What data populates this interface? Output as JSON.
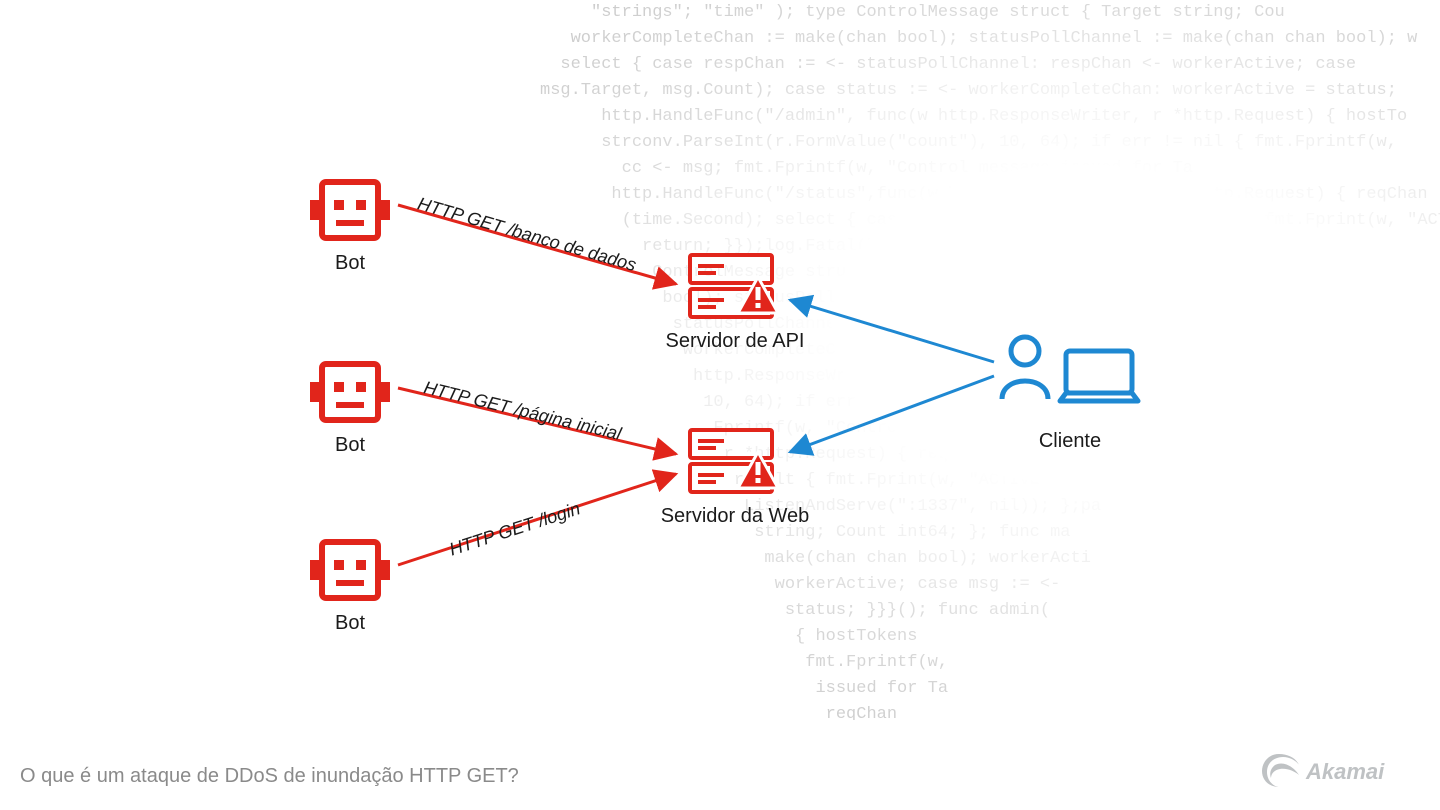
{
  "caption": "O que é um ataque de DDoS de inundação HTTP GET?",
  "nodes": {
    "bot1": {
      "label": "Bot"
    },
    "bot2": {
      "label": "Bot"
    },
    "bot3": {
      "label": "Bot"
    },
    "api_server": {
      "label": "Servidor de API"
    },
    "web_server": {
      "label": "Servidor da Web"
    },
    "client": {
      "label": "Cliente"
    }
  },
  "edges": {
    "bot1_api": {
      "label": "HTTP GET /banco de dados"
    },
    "bot2_web": {
      "label": "HTTP GET /página inicial"
    },
    "bot3_web": {
      "label": "HTTP GET /login"
    }
  },
  "colors": {
    "red": "#e1251b",
    "blue": "#1e88d2",
    "grey": "#8a8a8a"
  },
  "brand": "Akamai",
  "bg_code": "     \"strings\"; \"time\" ); type ControlMessage struct { Target string; Cou\n   workerCompleteChan := make(chan bool); statusPollChannel := make(chan chan bool); w\n  select { case respChan := <- statusPollChannel: respChan <- workerActive; case\nmsg.Target, msg.Count); case status := <- workerCompleteChan: workerActive = status;\n      http.HandleFunc(\"/admin\", func(w http.ResponseWriter, r *http.Request) { hostTo\n      strconv.ParseInt(r.FormValue(\"count\"), 10, 64); if err != nil { fmt.Fprintf(w,\n        cc <- msg; fmt.Fprintf(w, \"Control message issued for Ta\n       http.HandleFunc(\"/status\",func(w http.ResponseWriter, r *http.Request) { reqChan\n        (time.Second); select { case result := <- reqChan: if result { fmt.Fprint(w, \"ACTIVE\"\n          return; }});log.Fatal(http.ListenAndServe(\":1337\", nil)); };pa\n           ControlMessage struct { Target string; Count int64; }; func ma\n            bool); statusPollChannel := make(chan chan bool); workerActi\n             statusPollChannel: respChan <- workerActive; case msg := <-\n              workerCompleteChan: workerActive = status; }}}(); func admin(\n               http.ResponseWriter, r *http.Request) { hostTokens\n                10, 64); if err != nil { fmt.Fprintf(w,\n                 Fprintf(w, \"Control message issued for Ta\n                  r *http.Request) { reqChan\n                   result { fmt.Fprint(w, \"ACTIVE\"\n                    ListenAndServe(\":1337\", nil)); };pa\n                     string; Count int64; }; func ma\n                      make(chan chan bool); workerActi\n                       workerActive; case msg := <-\n                        status; }}}(); func admin(\n                         { hostTokens\n                          fmt.Fprintf(w,\n                           issued for Ta\n                            reqChan"
}
